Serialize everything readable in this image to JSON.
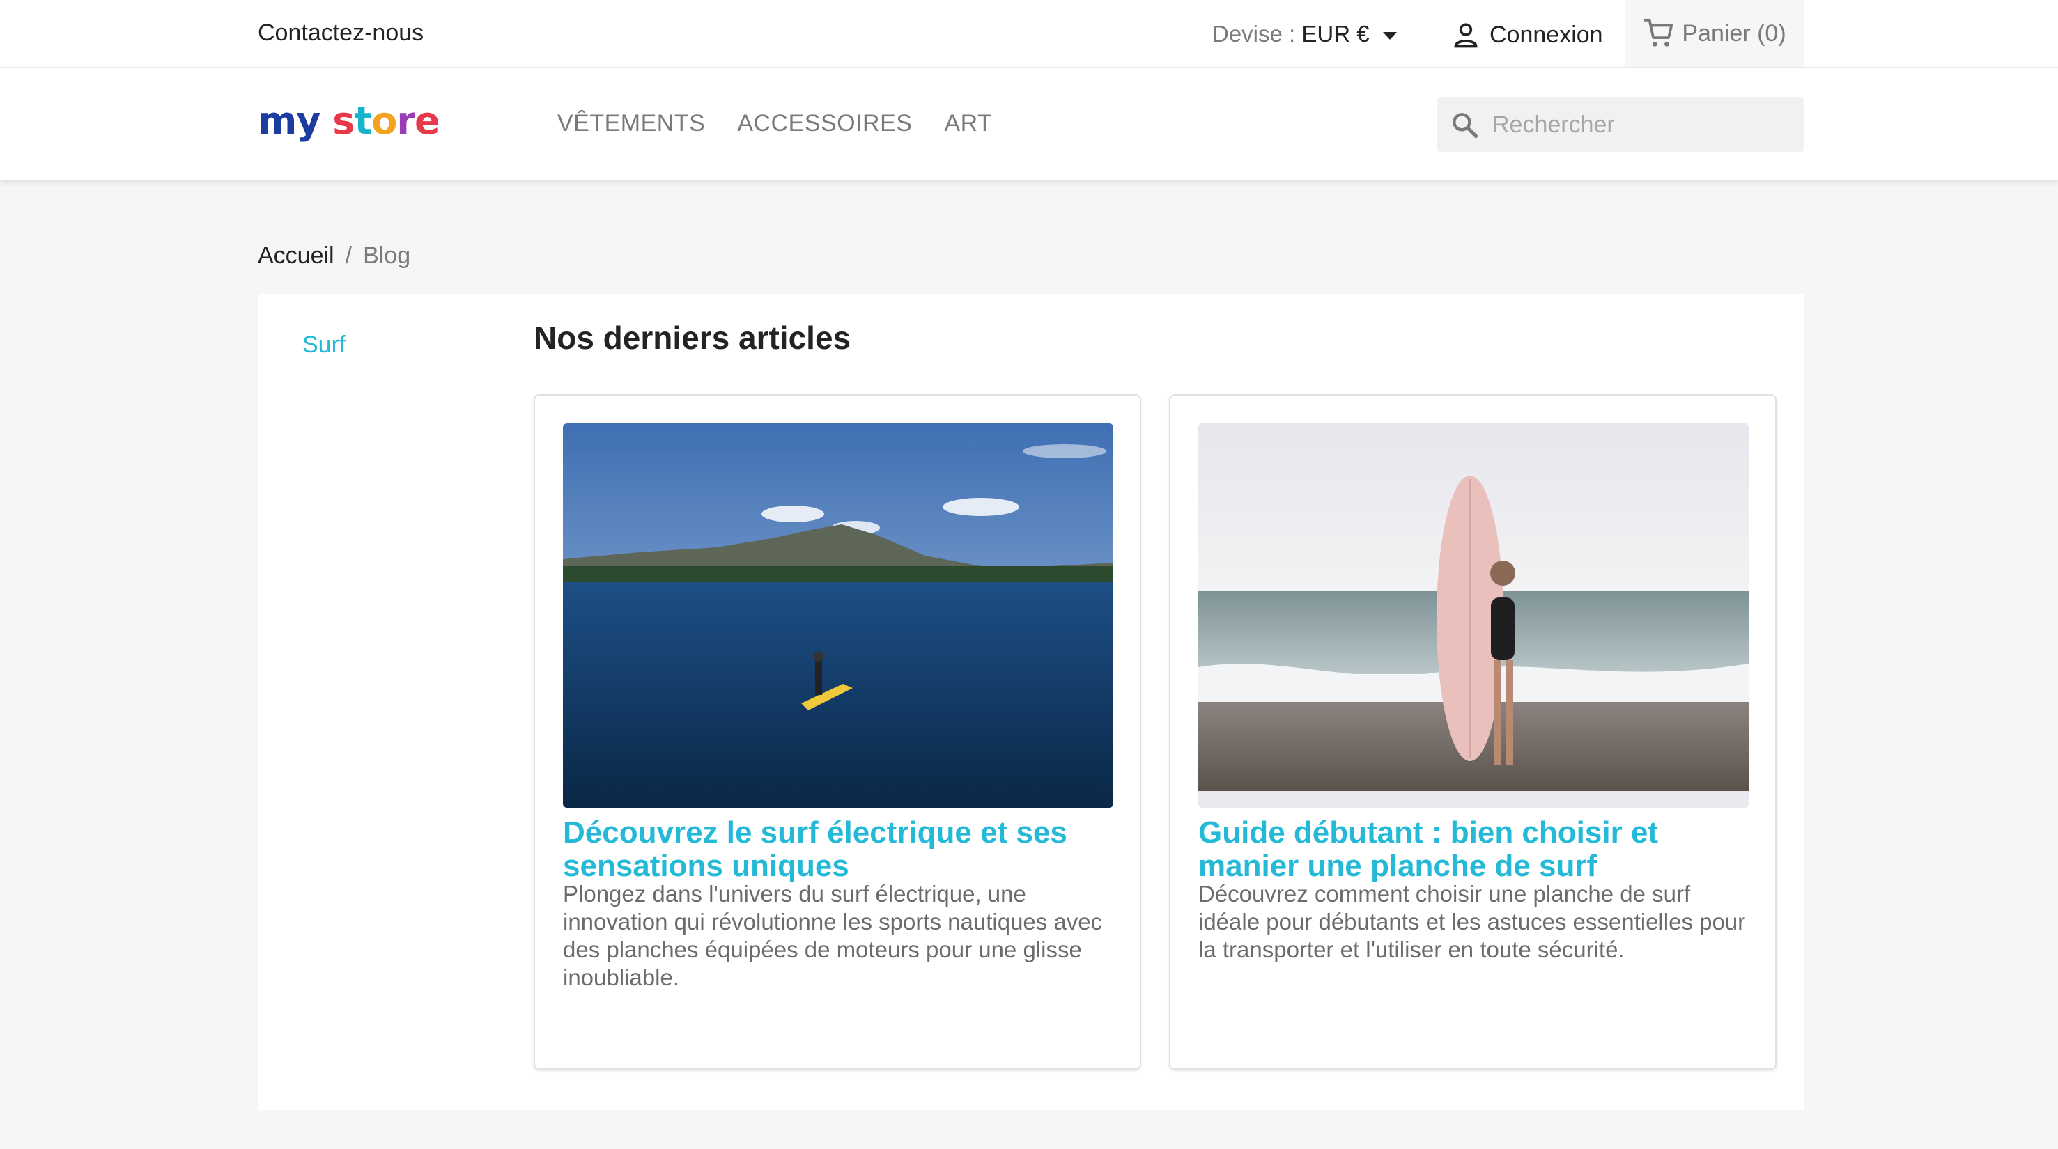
{
  "topbar": {
    "contact": "Contactez-nous",
    "currency_label": "Devise :",
    "currency_value": "EUR €",
    "login": "Connexion",
    "cart": "Panier (0)"
  },
  "header": {
    "logo_text": "my store",
    "menu": [
      "VÊTEMENTS",
      "ACCESSOIRES",
      "ART"
    ],
    "search_placeholder": "Rechercher"
  },
  "breadcrumb": {
    "home": "Accueil",
    "separator": "/",
    "current": "Blog"
  },
  "sidebar": {
    "categories": [
      "Surf"
    ]
  },
  "main": {
    "title": "Nos derniers articles",
    "articles": [
      {
        "title": "Découvrez le surf électrique et ses sensations uniques",
        "excerpt": "Plongez dans l'univers du surf électrique, une innovation qui révolutionne les sports nautiques avec des planches équipées de moteurs pour une glisse inoubliable."
      },
      {
        "title": "Guide débutant : bien choisir et manier une planche de surf",
        "excerpt": "Découvrez comment choisir une planche de surf idéale pour débutants et les astuces essentielles pour la transporter et l'utiliser en toute sécurité."
      }
    ]
  },
  "icons": {
    "login": "person-icon",
    "cart": "shopping-cart-icon",
    "search": "search-icon",
    "currency_dropdown": "caret-down-icon"
  },
  "colors": {
    "accent": "#24b9d7",
    "background": "#f6f6f6",
    "text": "#232323",
    "muted": "#7a7a7a"
  }
}
